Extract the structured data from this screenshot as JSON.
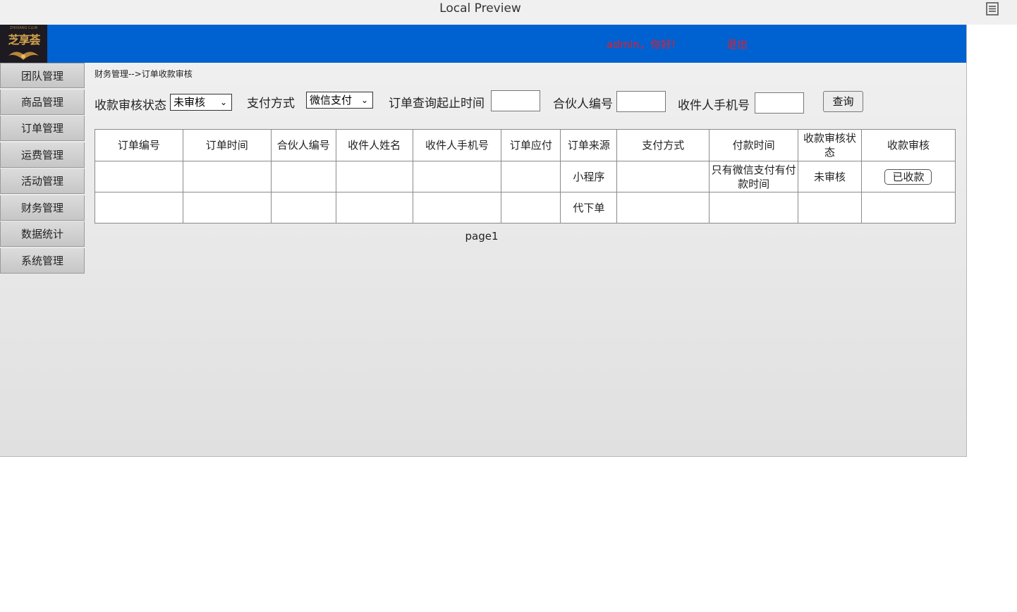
{
  "window": {
    "title": "Local Preview",
    "menu_icon": "list-menu-icon"
  },
  "header": {
    "logo_text": "芝享荟",
    "logo_sub": "ZHIXIANG CLUB",
    "greeting": "admin，你好!",
    "logout": "退出",
    "bg_color": "#0061d1",
    "accent_text_color": "#e0202a"
  },
  "sidebar": {
    "items": [
      {
        "label": "团队管理"
      },
      {
        "label": "商品管理"
      },
      {
        "label": "订单管理"
      },
      {
        "label": "运费管理"
      },
      {
        "label": "活动管理"
      },
      {
        "label": "财务管理"
      },
      {
        "label": "数据统计"
      },
      {
        "label": "系统管理"
      }
    ]
  },
  "breadcrumb": "财务管理-->订单收款审核",
  "filters": {
    "review_status_label": "收款审核状态",
    "review_status_value": "未审核",
    "payment_method_label": "支付方式",
    "payment_method_value": "微信支付",
    "date_range_label": "订单查询起止时间",
    "date_range_value": "",
    "partner_id_label": "合伙人编号",
    "partner_id_value": "",
    "receiver_phone_label": "收件人手机号",
    "receiver_phone_value": "",
    "query_button": "查询"
  },
  "table": {
    "headers": [
      "订单编号",
      "订单时间",
      "合伙人编号",
      "收件人姓名",
      "收件人手机号",
      "订单应付",
      "订单来源",
      "支付方式",
      "付款时间",
      "收款审核状态",
      "收款审核"
    ],
    "rows": [
      [
        "",
        "",
        "",
        "",
        "",
        "",
        "小程序",
        "",
        "只有微信支付有付款时间",
        "未审核",
        "已收款"
      ],
      [
        "",
        "",
        "",
        "",
        "",
        "",
        "代下单",
        "",
        "",
        "",
        ""
      ]
    ]
  },
  "pager": "page1"
}
